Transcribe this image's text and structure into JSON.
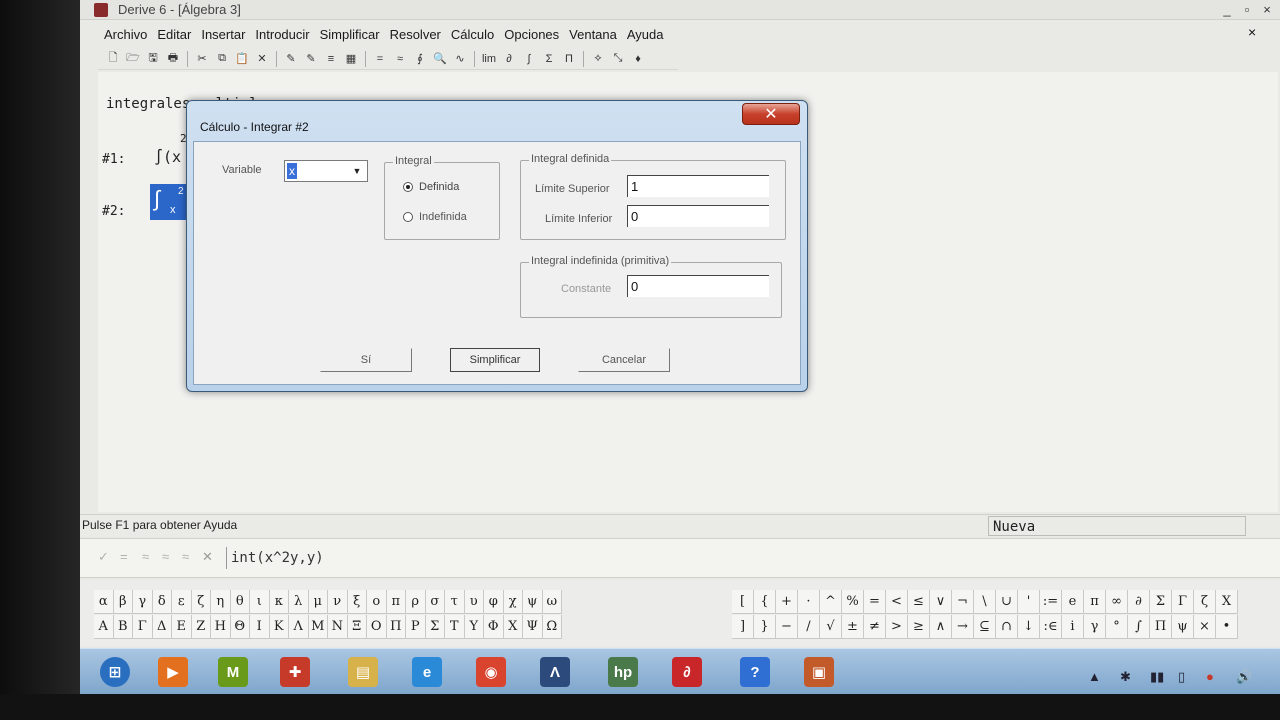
{
  "window": {
    "title": "Derive 6 - [Álgebra 3]",
    "controls": [
      "_",
      "▫",
      "×"
    ]
  },
  "menu": [
    "Archivo",
    "Editar",
    "Insertar",
    "Introducir",
    "Simplificar",
    "Resolver",
    "Cálculo",
    "Opciones",
    "Ventana",
    "Ayuda"
  ],
  "menu_close": "×",
  "toolbar": [
    "🗋",
    "🗁",
    "🖫",
    "🖶",
    "✂",
    "⧉",
    "📋",
    "✕",
    "✎",
    "✎",
    "≡",
    "▦",
    "=",
    "≈",
    "∮",
    "🔍",
    "∿",
    "lim",
    "∂",
    "∫",
    "Σ",
    "Π",
    "⟡",
    "⤡",
    "♦"
  ],
  "workspace": {
    "title": "integrales multiples",
    "expr1_label": "#1:",
    "expr1_text": "∫(x",
    "expr1_sup": "2",
    "expr2_label": "#2:",
    "expr2_int": "∫",
    "expr2_sup": "2",
    "expr2_x": "x"
  },
  "status": {
    "help": "Pulse F1 para obtener Ayuda",
    "mode": "Nueva"
  },
  "entry": {
    "icons": [
      "✓",
      "=",
      "≈",
      "≈",
      "≈",
      "✕"
    ],
    "value": "int(x^2y,y)"
  },
  "greek_lower": [
    "α",
    "β",
    "γ",
    "δ",
    "ε",
    "ζ",
    "η",
    "θ",
    "ι",
    "κ",
    "λ",
    "μ",
    "ν",
    "ξ",
    "ο",
    "π",
    "ρ",
    "σ",
    "τ",
    "υ",
    "φ",
    "χ",
    "ψ",
    "ω"
  ],
  "greek_upper": [
    "Α",
    "Β",
    "Γ",
    "Δ",
    "Ε",
    "Ζ",
    "Η",
    "Θ",
    "Ι",
    "Κ",
    "Λ",
    "Μ",
    "Ν",
    "Ξ",
    "Ο",
    "Π",
    "Ρ",
    "Σ",
    "Τ",
    "Υ",
    "Φ",
    "Χ",
    "Ψ",
    "Ω"
  ],
  "math_row1": [
    "[",
    "{",
    "+",
    "·",
    "^",
    "%",
    "=",
    "<",
    "≤",
    "∨",
    "¬",
    "\\",
    "∪",
    "'",
    ":=",
    "e",
    "π",
    "∞",
    "∂",
    "Σ",
    "Γ",
    "ζ",
    "X"
  ],
  "math_row2": [
    "]",
    "}",
    "−",
    "/",
    "√",
    "±",
    "≠",
    ">",
    "≥",
    "∧",
    "→",
    "⊆",
    "∩",
    "↓",
    ":∈",
    "i",
    "γ",
    "°",
    "∫",
    "Π",
    "ψ",
    "×",
    "•"
  ],
  "dialog": {
    "title": "Cálculo - Integrar #2",
    "close": "✕",
    "variable_label": "Variable",
    "variable_value": "x",
    "integral_group": "Integral",
    "definida": "Definida",
    "indefinida": "Indefinida",
    "definite_group": "Integral definida",
    "upper_label": "Límite Superior",
    "upper_value": "1",
    "lower_label": "Límite Inferior",
    "lower_value": "0",
    "indef_group": "Integral indefinida (primitiva)",
    "constant_label": "Constante",
    "constant_value": "0",
    "btn_si": "Sí",
    "btn_simplify": "Simplificar",
    "btn_cancel": "Cancelar"
  },
  "taskbar": {
    "apps": [
      {
        "name": "windows-start",
        "glyph": "⊞",
        "color": "#2a6ec0"
      },
      {
        "name": "media-player",
        "glyph": "▶",
        "color": "#e2701e"
      },
      {
        "name": "messenger",
        "glyph": "M",
        "color": "#6a9a1a"
      },
      {
        "name": "app-red",
        "glyph": "✚",
        "color": "#c63a2a"
      },
      {
        "name": "folder",
        "glyph": "▤",
        "color": "#d7b14a"
      },
      {
        "name": "internet-explorer",
        "glyph": "e",
        "color": "#2a8ad8"
      },
      {
        "name": "chrome",
        "glyph": "◉",
        "color": "#d9442f"
      },
      {
        "name": "derive",
        "glyph": "Λ",
        "color": "#2c4a7c"
      },
      {
        "name": "hp",
        "glyph": "hp",
        "color": "#4a7a4a"
      },
      {
        "name": "acrobat",
        "glyph": "∂",
        "color": "#c9262a"
      },
      {
        "name": "help",
        "glyph": "?",
        "color": "#2f6fd4"
      },
      {
        "name": "derive-window",
        "glyph": "▣",
        "color": "#c35a2a"
      }
    ],
    "tray": [
      "▲",
      "✱",
      "▮▮",
      "▯",
      "●",
      "🔊"
    ]
  }
}
